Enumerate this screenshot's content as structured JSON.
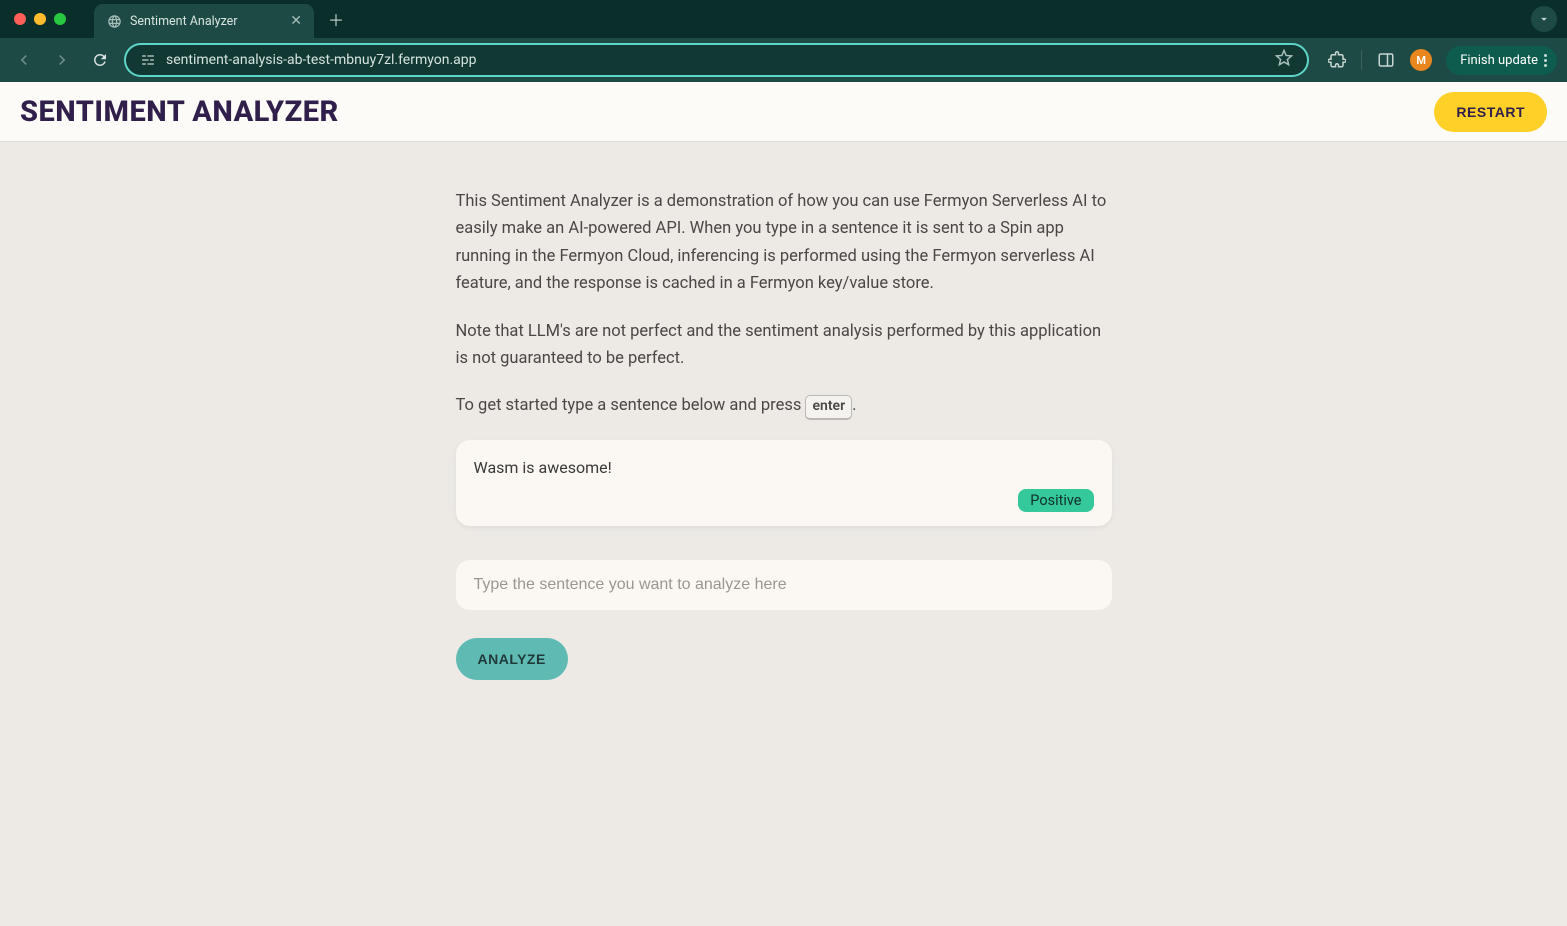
{
  "browser": {
    "tab_title": "Sentiment Analyzer",
    "url": "sentiment-analysis-ab-test-mbnuy7zl.fermyon.app",
    "avatar_initial": "M",
    "finish_update_label": "Finish update"
  },
  "app": {
    "title": "SENTIMENT ANALYZER",
    "restart_label": "RESTART",
    "paragraph1": "This Sentiment Analyzer is a demonstration of how you can use Fermyon Serverless AI to easily make an AI-powered API. When you type in a sentence it is sent to a Spin app running in the Fermyon Cloud, inferencing is performed using the Fermyon serverless AI feature, and the response is cached in a Fermyon key/value store.",
    "paragraph2": "Note that LLM's are not perfect and the sentiment analysis performed by this application is not guaranteed to be perfect.",
    "paragraph3_prefix": "To get started type a sentence below and press ",
    "paragraph3_kbd": "enter",
    "paragraph3_suffix": ".",
    "result": {
      "text": "Wasm is awesome!",
      "badge": "Positive"
    },
    "input_placeholder": "Type the sentence you want to analyze here",
    "analyze_label": "ANALYZE"
  }
}
